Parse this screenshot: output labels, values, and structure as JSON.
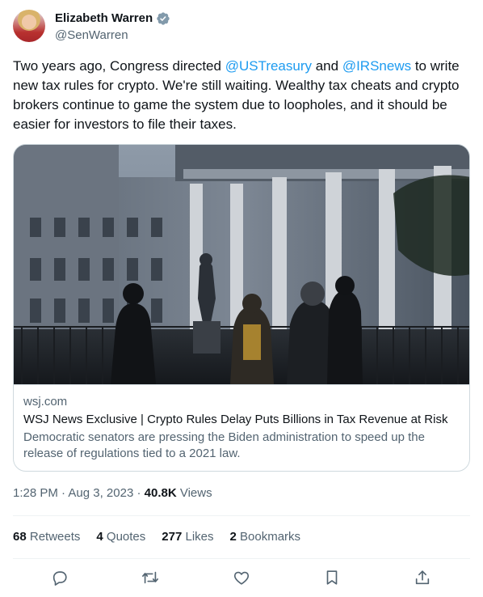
{
  "author": {
    "display_name": "Elizabeth Warren",
    "handle": "@SenWarren",
    "verified_badge": "verified-badge-icon",
    "avatar": "avatar-image"
  },
  "tweet": {
    "text_1": "Two years ago, Congress directed ",
    "mention_1": "@USTreasury",
    "text_2": " and ",
    "mention_2": "@IRSnews",
    "text_3": " to write new tax rules for crypto. We're still waiting. Wealthy tax cheats and crypto brokers continue to game the system due to loopholes, and it should be easier for investors to file their taxes."
  },
  "card": {
    "image": "treasury-building-photo",
    "domain": "wsj.com",
    "title": "WSJ News Exclusive | Crypto Rules Delay Puts Billions in Tax Revenue at Risk",
    "description": "Democratic senators are pressing the Biden administration to speed up the release of regulations tied to a 2021 law."
  },
  "meta": {
    "time": "1:28 PM",
    "separator_1": " · ",
    "date": "Aug 3, 2023",
    "separator_2": " · ",
    "views_count": "40.8K",
    "views_label": " Views"
  },
  "stats": {
    "retweets_count": "68",
    "retweets_label": "Retweets",
    "quotes_count": "4",
    "quotes_label": "Quotes",
    "likes_count": "277",
    "likes_label": "Likes",
    "bookmarks_count": "2",
    "bookmarks_label": "Bookmarks"
  },
  "actions": [
    "reply-icon",
    "retweet-icon",
    "like-icon",
    "bookmark-icon",
    "share-icon"
  ],
  "colors": {
    "text": "#0f1419",
    "secondary": "#536471",
    "link": "#1d9bf0",
    "border": "#cfd9de",
    "divider": "#eff3f4",
    "verified": "#829aab"
  }
}
